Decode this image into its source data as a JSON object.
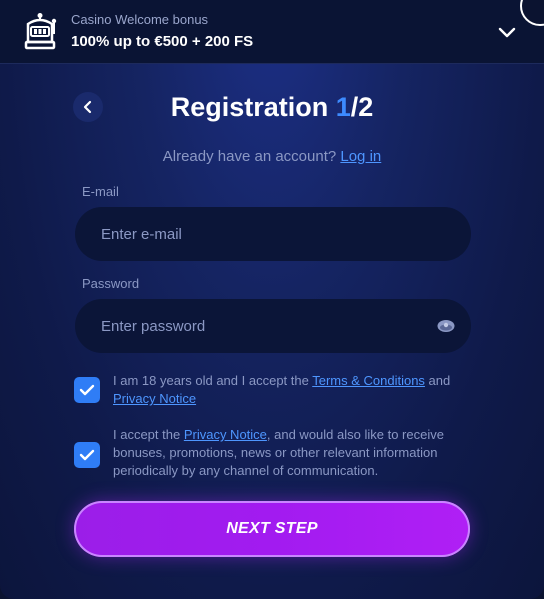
{
  "bonus": {
    "label": "Casino Welcome bonus",
    "title": "100% up to €500 + 200 FS"
  },
  "header": {
    "title_prefix": "Registration ",
    "step_current": "1",
    "step_total": "/2"
  },
  "login": {
    "prompt": "Already have an account?",
    "link": "Log in"
  },
  "fields": {
    "email": {
      "label": "E-mail",
      "placeholder": "Enter e-mail",
      "value": ""
    },
    "password": {
      "label": "Password",
      "placeholder": "Enter password",
      "value": ""
    }
  },
  "consents": [
    {
      "checked": true,
      "text_a": "I am 18 years old and I accept the ",
      "link_a": "Terms & Conditions",
      "text_b": " and ",
      "link_b": "Privacy Notice",
      "text_c": ""
    },
    {
      "checked": true,
      "text_a": "I accept the ",
      "link_a": "Privacy Notice",
      "text_b": ", and would also like to receive bonuses, promotions, news or other relevant information periodically by any channel of communication.",
      "link_b": "",
      "text_c": ""
    }
  ],
  "actions": {
    "next_label": "NEXT STEP"
  },
  "icons": [
    "slot-machine-icon",
    "chevron-down-icon",
    "chevron-left-icon",
    "eye-icon",
    "checkmark-icon"
  ],
  "colors": {
    "accent_blue": "#3d8bff",
    "link_blue": "#4e96ff",
    "button_purple": "#a21bf0"
  }
}
